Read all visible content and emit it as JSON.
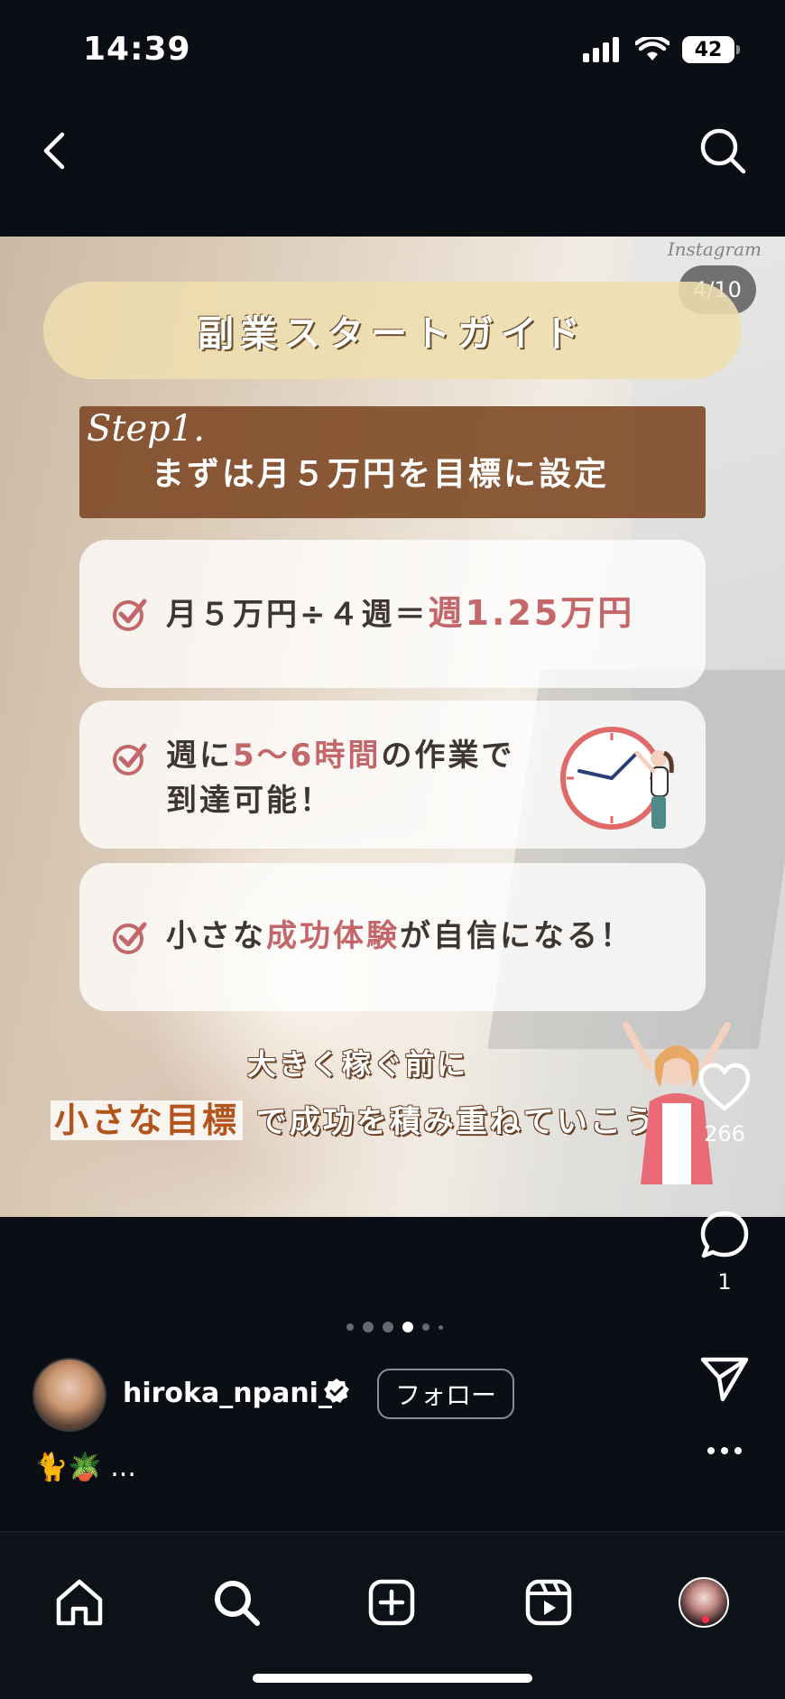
{
  "status_bar": {
    "time": "14:39",
    "battery": "42"
  },
  "post": {
    "watermark": "Instagram",
    "page_counter": "4/10",
    "title": "副業スタートガイド",
    "step_label": "Step1.",
    "step_text": "まずは月５万円を目標に設定",
    "card1": {
      "prefix": "月５万円÷４週＝",
      "highlight": "週1.25万円"
    },
    "card2": {
      "line1_a": "週に",
      "line1_highlight": "5〜6時間",
      "line1_b": "の作業で",
      "line2": "到達可能！"
    },
    "card3": {
      "a": "小さな",
      "highlight": "成功体験",
      "b": "が自信になる！"
    },
    "footer_line1": "大きく稼ぐ前に",
    "footer_accent": "小さな目標",
    "footer_rest": "で成功を積み重ねていこう！"
  },
  "actions": {
    "likes": "266",
    "comments": "1"
  },
  "author": {
    "username": "hiroka_npani_",
    "follow_label": "フォロー",
    "caption": "🐈🪴 ..."
  },
  "icons": [
    "back-icon",
    "search-icon",
    "heart-icon",
    "comment-icon",
    "send-icon",
    "more-icon",
    "home-icon",
    "create-icon",
    "reels-icon",
    "verified-icon",
    "check-icon"
  ],
  "colors": {
    "background": "#0b0e14",
    "highlight": "#c3676b",
    "step_bar": "#7e4926",
    "title_pill": "#eedeaf"
  }
}
